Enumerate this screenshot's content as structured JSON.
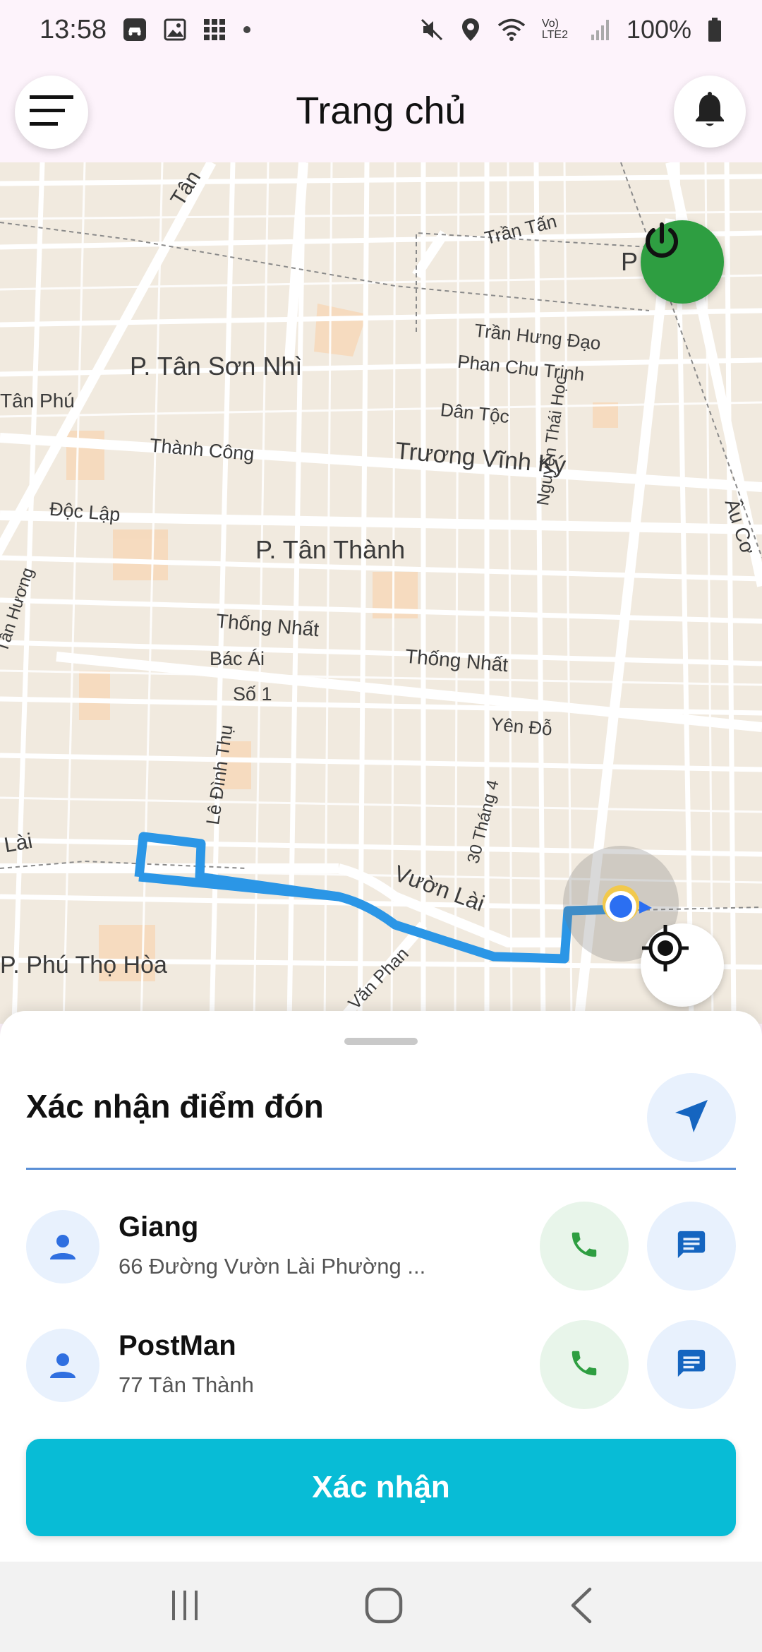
{
  "status_bar": {
    "time": "13:58",
    "battery": "100%",
    "network_label": "Vo) LTE2",
    "icons": [
      "car-app-icon",
      "gallery-icon",
      "grid-app-icon",
      "dot-icon",
      "mute-icon",
      "location-icon",
      "wifi-icon",
      "signal-icon",
      "battery-icon"
    ]
  },
  "header": {
    "title": "Trang chủ",
    "menu_icon": "hamburger-icon",
    "notification_icon": "bell-icon"
  },
  "map": {
    "labels": {
      "tan_top": "Tân",
      "tran_tan": "Trần Tấn",
      "p_edge": "P",
      "tran_hung_dao": "Trần Hưng Đạo",
      "phan_chu_trinh": "Phan Chu Trinh",
      "dan_toc": "Dân Tộc",
      "p_tan_son_nhi": "P. Tân Sơn Nhì",
      "tan_phu": "Tân Phú",
      "thanh_cong": "Thành Công",
      "truong_vinh_ky": "Trương Vĩnh Ký",
      "doc_lap": "Độc Lập",
      "p_tan_thanh": "P. Tân Thành",
      "nguyen_thai_hoc": "Nguyễn Thái Học",
      "au_co": "Âu Cơ",
      "tan_huong": "Tân Hương",
      "thong_nhat_1": "Thống Nhất",
      "thong_nhat_2": "Thống Nhất",
      "bac_ai": "Bác Ái",
      "so_1": "Số 1",
      "yen_do": "Yên Đỗ",
      "le_dinh_thu": "Lê Đình Thụ",
      "thang_4": "30 Tháng 4",
      "lai_left": "Lài",
      "vuon_lai": "Vườn Lài",
      "p_phu_tho_hoa": "P. Phú Thọ Hòa",
      "van_phan": "Văn Phan"
    },
    "power_icon": "power-icon",
    "recenter_icon": "crosshair-icon",
    "location_marker": "current-location-marker",
    "power_color": "#2e9e41",
    "route_color": "#2b96e6"
  },
  "sheet": {
    "title": "Xác nhận điểm đón",
    "navigate_icon": "navigation-arrow-icon",
    "people": [
      {
        "name": "Giang",
        "address": "66 Đường Vườn Lài Phường ..."
      },
      {
        "name": "PostMan",
        "address": "77 Tân Thành"
      }
    ],
    "confirm_label": "Xác nhận",
    "confirm_color": "#08bcd6"
  },
  "nav_bar": {
    "icons": [
      "recents-icon",
      "home-icon",
      "back-icon"
    ]
  }
}
